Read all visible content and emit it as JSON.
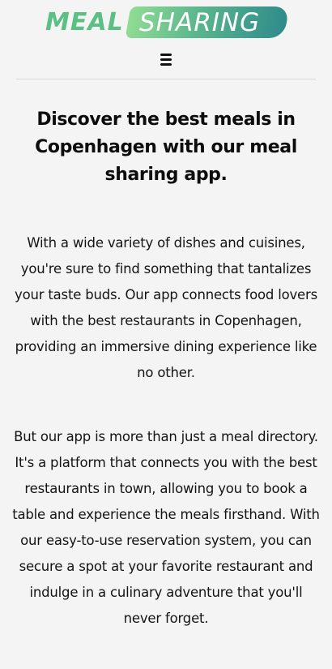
{
  "logo": {
    "word1": "MEAL",
    "word2": "SHARING",
    "colors": {
      "word1": "#5cbf84",
      "pill_start": "#8fdc93",
      "pill_end": "#2f8b8a",
      "word2": "#ffffff"
    }
  },
  "nav": {
    "menu_icon": "hamburger-icon"
  },
  "main": {
    "headline": "Discover the best meals in Copenhagen with our meal sharing app.",
    "paragraphs": [
      "With a wide variety of dishes and cuisines, you're sure to find something that tantalizes your taste buds. Our app connects food lovers with the best restaurants in Copenhagen, providing an immersive dining experience like no other.",
      "But our app is more than just a meal directory. It's a platform that connects you with the best restaurants in town, allowing you to book a table and experience the meals firsthand. With our easy-to-use reservation system, you can secure a spot at your favorite restaurant and indulge in a culinary adventure that you'll never forget."
    ]
  },
  "colors": {
    "background": "#f4f4f4",
    "text": "#111111",
    "divider": "#d8d8d8"
  }
}
